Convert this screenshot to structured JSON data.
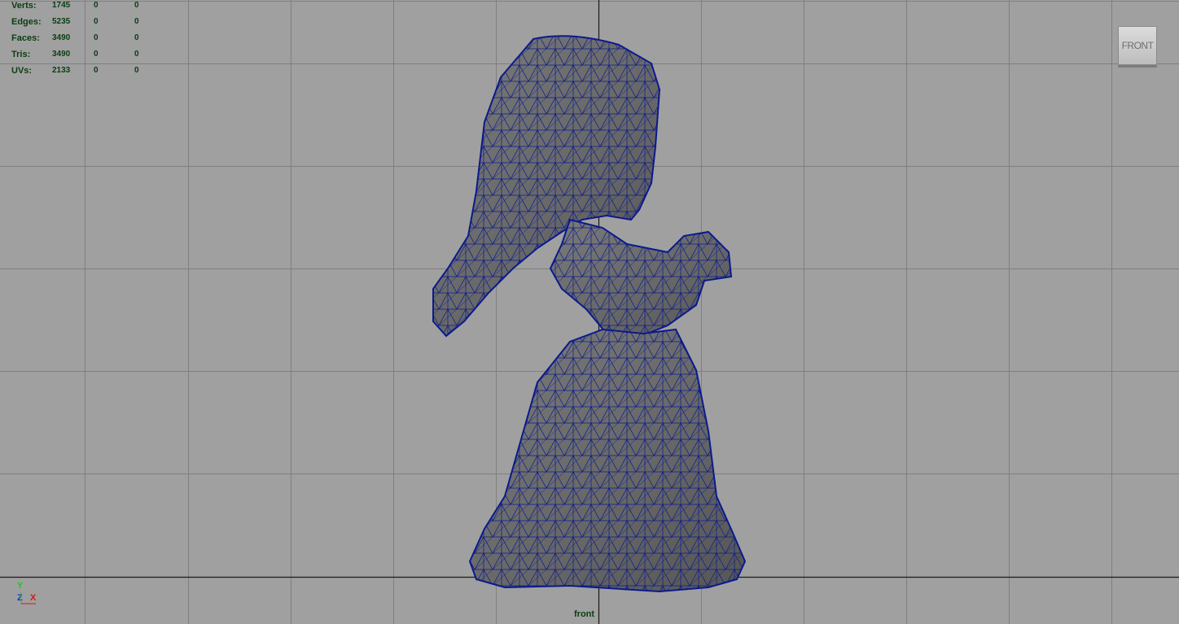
{
  "hud": {
    "rows": [
      {
        "label": "Verts:",
        "values": [
          "1745",
          "0",
          "0"
        ]
      },
      {
        "label": "Edges:",
        "values": [
          "5235",
          "0",
          "0"
        ]
      },
      {
        "label": "Faces:",
        "values": [
          "3490",
          "0",
          "0"
        ]
      },
      {
        "label": "Tris:",
        "values": [
          "3490",
          "0",
          "0"
        ]
      },
      {
        "label": "UVs:",
        "values": [
          "2133",
          "0",
          "0"
        ]
      }
    ]
  },
  "viewcube": {
    "label": "FRONT"
  },
  "camera": {
    "label": "front"
  },
  "axis": {
    "y": "Y",
    "z": "Z",
    "x": "X"
  },
  "colors": {
    "background": "#a0a0a0",
    "grid": "#7f7f7f",
    "origin_axis": "#1a1a1a",
    "mesh_fill": "#6e6e6e",
    "wireframe": "#0a1a8c",
    "hud_text": "#0b3d10"
  },
  "model": {
    "name": "character-mesh-wireframe"
  }
}
